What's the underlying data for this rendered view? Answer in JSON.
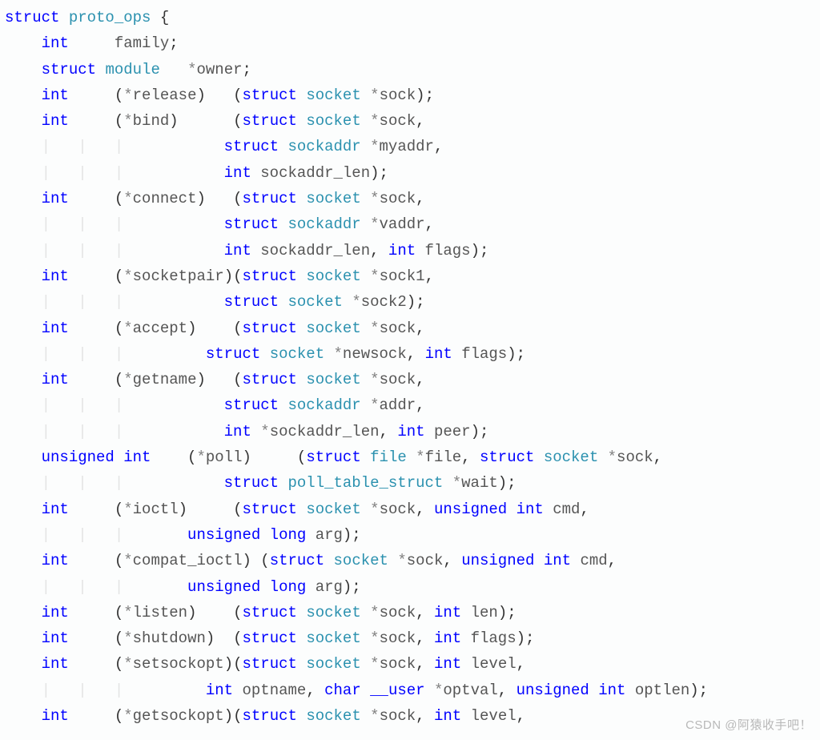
{
  "watermark": "CSDN @阿猿收手吧！",
  "code": {
    "tokens": {
      "struct": "struct",
      "int": "int",
      "unsigned": "unsigned",
      "long": "long",
      "char": "char",
      "proto_ops": "proto_ops",
      "module": "module",
      "socket": "socket",
      "sockaddr": "sockaddr",
      "file": "file",
      "poll_table_struct": "poll_table_struct",
      "__user": "__user"
    },
    "fields": {
      "family": "family",
      "owner": "owner",
      "release": "release",
      "bind": "bind",
      "connect": "connect",
      "socketpair": "socketpair",
      "accept": "accept",
      "getname": "getname",
      "poll": "poll",
      "ioctl": "ioctl",
      "compat_ioctl": "compat_ioctl",
      "listen": "listen",
      "shutdown": "shutdown",
      "setsockopt": "setsockopt",
      "getsockopt": "getsockopt"
    },
    "params": {
      "sock": "sock",
      "myaddr": "myaddr",
      "sockaddr_len": "sockaddr_len",
      "vaddr": "vaddr",
      "flags": "flags",
      "sock1": "sock1",
      "sock2": "sock2",
      "newsock": "newsock",
      "addr": "addr",
      "peer": "peer",
      "file_p": "file",
      "wait": "wait",
      "cmd": "cmd",
      "arg": "arg",
      "len": "len",
      "level": "level",
      "optname": "optname",
      "optval": "optval",
      "optlen": "optlen"
    },
    "guide1": "|   ",
    "guide2": "|   |   |   "
  }
}
